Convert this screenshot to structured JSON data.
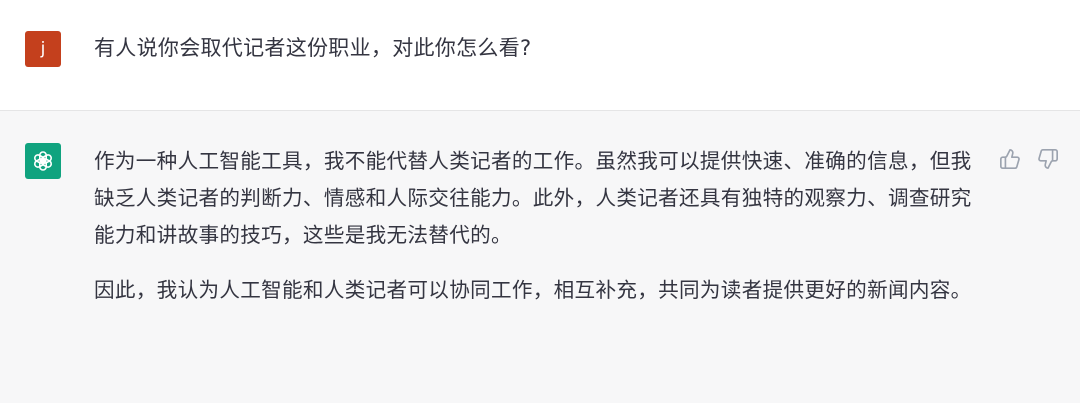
{
  "conversation": {
    "user_message": {
      "avatar_letter": "j",
      "text": "有人说你会取代记者这份职业，对此你怎么看?"
    },
    "assistant_message": {
      "avatar_icon": "chatgpt-logo-icon",
      "paragraphs": [
        "作为一种人工智能工具，我不能代替人类记者的工作。虽然我可以提供快速、准确的信息，但我缺乏人类记者的判断力、情感和人际交往能力。此外，人类记者还具有独特的观察力、调查研究能力和讲故事的技巧，这些是我无法替代的。",
        "因此，我认为人工智能和人类记者可以协同工作，相互补充，共同为读者提供更好的新闻内容。"
      ],
      "feedback_icons": [
        "thumbs-up-icon",
        "thumbs-down-icon"
      ]
    }
  },
  "colors": {
    "user_avatar_bg": "#c4401d",
    "assistant_avatar_bg": "#10a37f",
    "assistant_row_bg": "#f7f7f8",
    "text": "#343541",
    "icon": "#9ca3af"
  }
}
